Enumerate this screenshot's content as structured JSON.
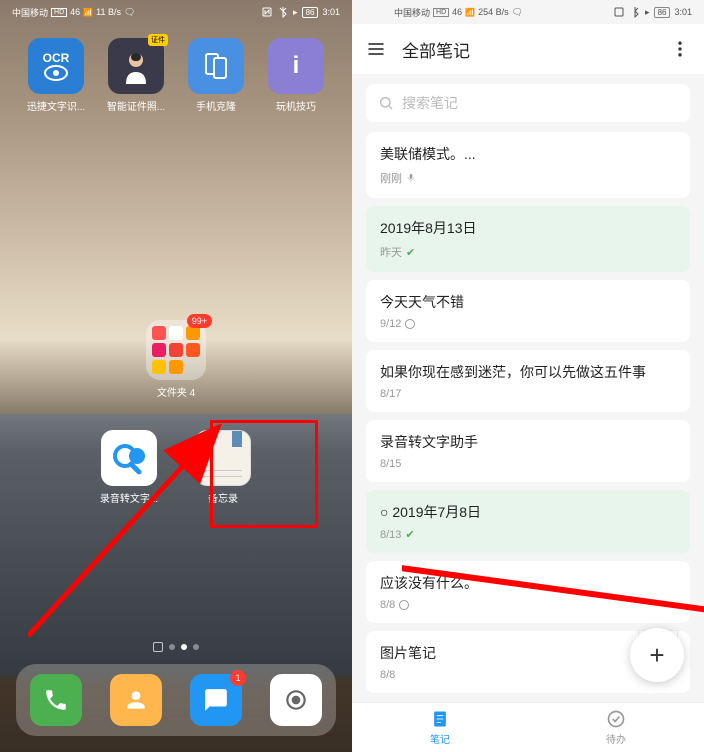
{
  "status": {
    "carrier": "中国移动",
    "hd": "HD",
    "signal": "46",
    "speed": "11 B/s",
    "speed_r": "254 B/s",
    "battery": "86",
    "time": "3:01"
  },
  "left": {
    "apps": [
      {
        "label": "迅捷文字识...",
        "bg": "#2a7fd4",
        "icon": "OCR"
      },
      {
        "label": "智能证件照...",
        "bg": "#3a3a4a",
        "icon": "person"
      },
      {
        "label": "手机克隆",
        "bg": "#4a90e2",
        "icon": "clone"
      },
      {
        "label": "玩机技巧",
        "bg": "#8b7fd4",
        "icon": "i"
      }
    ],
    "folder": {
      "label": "文件夹 4",
      "badge": "99+"
    },
    "mid_apps": [
      {
        "label": "录音转文字...",
        "bg": "#ffffff",
        "icon": "record"
      },
      {
        "label": "备忘录",
        "bg": "#f5f0e8",
        "icon": "memo"
      }
    ],
    "dock": [
      {
        "bg": "#4caf50",
        "icon": "phone"
      },
      {
        "bg": "#ffb74d",
        "icon": "contacts"
      },
      {
        "bg": "#2196f3",
        "icon": "message",
        "badge": "1"
      },
      {
        "bg": "#ffffff",
        "icon": "camera"
      }
    ]
  },
  "right": {
    "title": "全部笔记",
    "search_placeholder": "搜索笔记",
    "notes": [
      {
        "title": "美联储模式。...",
        "meta": "刚刚",
        "mic": true
      },
      {
        "title": "2019年8月13日",
        "meta": "昨天",
        "green": true,
        "check": true
      },
      {
        "title": "今天天气不错",
        "meta": "9/12",
        "hollow": true
      },
      {
        "title": "如果你现在感到迷茫，你可以先做这五件事",
        "meta": "8/17"
      },
      {
        "title": "录音转文字助手",
        "meta": "8/15"
      },
      {
        "title": "○ 2019年7月8日",
        "meta": "8/13",
        "green": true,
        "check": true
      },
      {
        "title": "应该没有什么。",
        "meta": "8/8",
        "hollow": true
      },
      {
        "title": "图片笔记",
        "meta": "8/8"
      }
    ],
    "tabs": [
      {
        "label": "笔记",
        "active": true
      },
      {
        "label": "待办",
        "active": false
      }
    ]
  }
}
